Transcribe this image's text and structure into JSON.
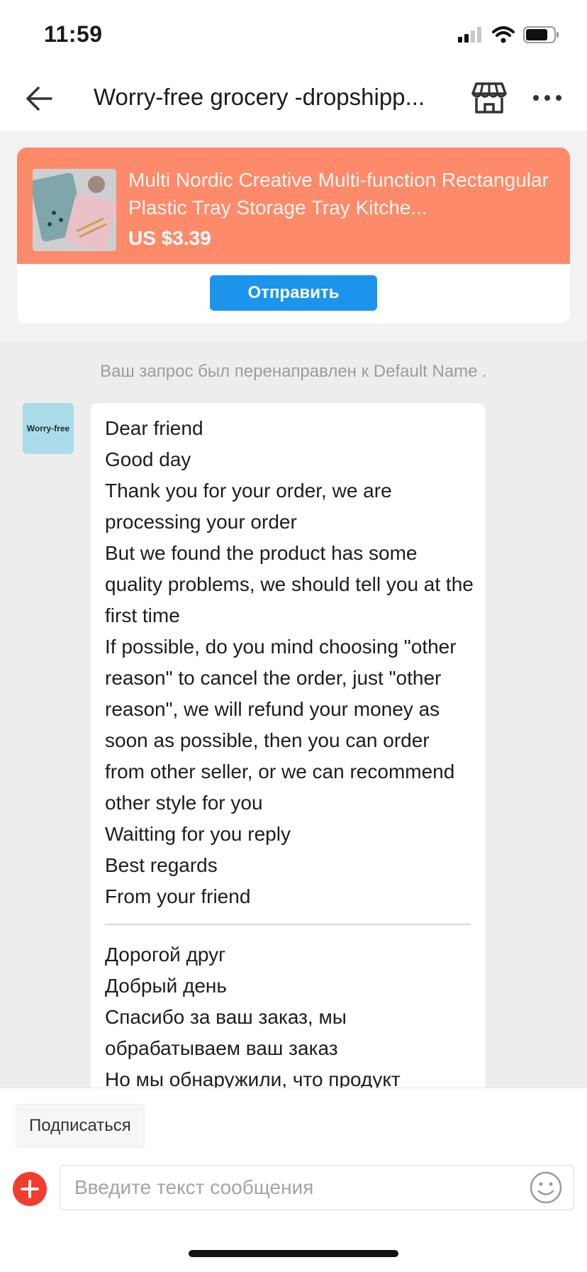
{
  "status_bar": {
    "time": "11:59",
    "icons": [
      "signal-icon",
      "wifi-icon",
      "battery-icon"
    ]
  },
  "nav": {
    "back_icon": "arrow-left-icon",
    "title": "Worry-free grocery -dropshipp...",
    "store_icon": "store-icon",
    "more_icon": "more-horizontal-icon"
  },
  "product": {
    "title": "Multi Nordic Creative Multi-function Rectangular Plastic Tray Storage Tray Kitche...",
    "price": "US $3.39",
    "send_label": "Отправить",
    "header_color": "#fd8a6a",
    "button_color": "#1b95ec"
  },
  "chat": {
    "system_message": "Ваш запрос был перенаправлен к Default Name .",
    "avatar_text": "Worry-free",
    "message_en": [
      "Dear friend",
      "Good day",
      "Thank you for your order, we are processing your order",
      "But we found the product has some quality problems, we should tell you at the first time",
      "If possible, do you mind choosing \"other reason\" to cancel the order, just \"other reason\", we will refund your money as soon as possible, then you can order from other seller, or we can recommend other style for you",
      "Waitting for you reply",
      "Best regards",
      "From your friend"
    ],
    "message_ru": [
      "Дорогой друг",
      "Добрый день",
      "Спасибо за ваш заказ, мы обрабатываем ваш заказ",
      "Но мы обнаружили, что продукт"
    ]
  },
  "bottom": {
    "subscribe_label": "Подписаться",
    "add_icon": "plus-circle-icon",
    "input_placeholder": "Введите текст сообщения",
    "emoji_icon": "smiley-icon",
    "accent_color": "#f23c2d"
  }
}
